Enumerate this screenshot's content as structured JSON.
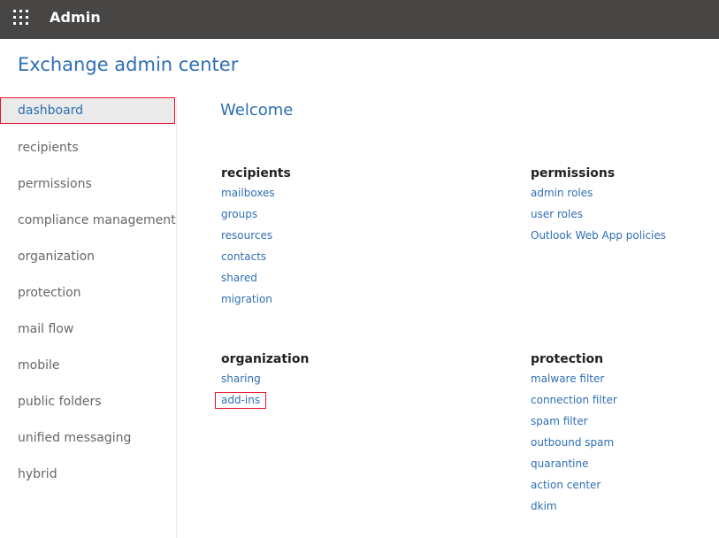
{
  "topbar": {
    "app_launcher_icon": "waffle-grid-icon",
    "title": "Admin"
  },
  "app_title": "Exchange admin center",
  "sidebar": {
    "items": [
      {
        "label": "dashboard",
        "active": true
      },
      {
        "label": "recipients"
      },
      {
        "label": "permissions"
      },
      {
        "label": "compliance management"
      },
      {
        "label": "organization"
      },
      {
        "label": "protection"
      },
      {
        "label": "mail flow"
      },
      {
        "label": "mobile"
      },
      {
        "label": "public folders"
      },
      {
        "label": "unified messaging"
      },
      {
        "label": "hybrid"
      }
    ]
  },
  "main": {
    "welcome": "Welcome",
    "groups": {
      "recipients": {
        "title": "recipients",
        "links": [
          "mailboxes",
          "groups",
          "resources",
          "contacts",
          "shared",
          "migration"
        ]
      },
      "permissions": {
        "title": "permissions",
        "links": [
          "admin roles",
          "user roles",
          "Outlook Web App policies"
        ]
      },
      "organization": {
        "title": "organization",
        "links": [
          "sharing",
          "add-ins"
        ]
      },
      "protection": {
        "title": "protection",
        "links": [
          "malware filter",
          "connection filter",
          "spam filter",
          "outbound spam",
          "quarantine",
          "action center",
          "dkim"
        ]
      }
    }
  },
  "colors": {
    "topbar": "#474645",
    "accent_blue": "#2e6fb3",
    "highlight_red": "#e8112d",
    "active_bg": "#eaeaea",
    "nav_text": "#676767"
  }
}
